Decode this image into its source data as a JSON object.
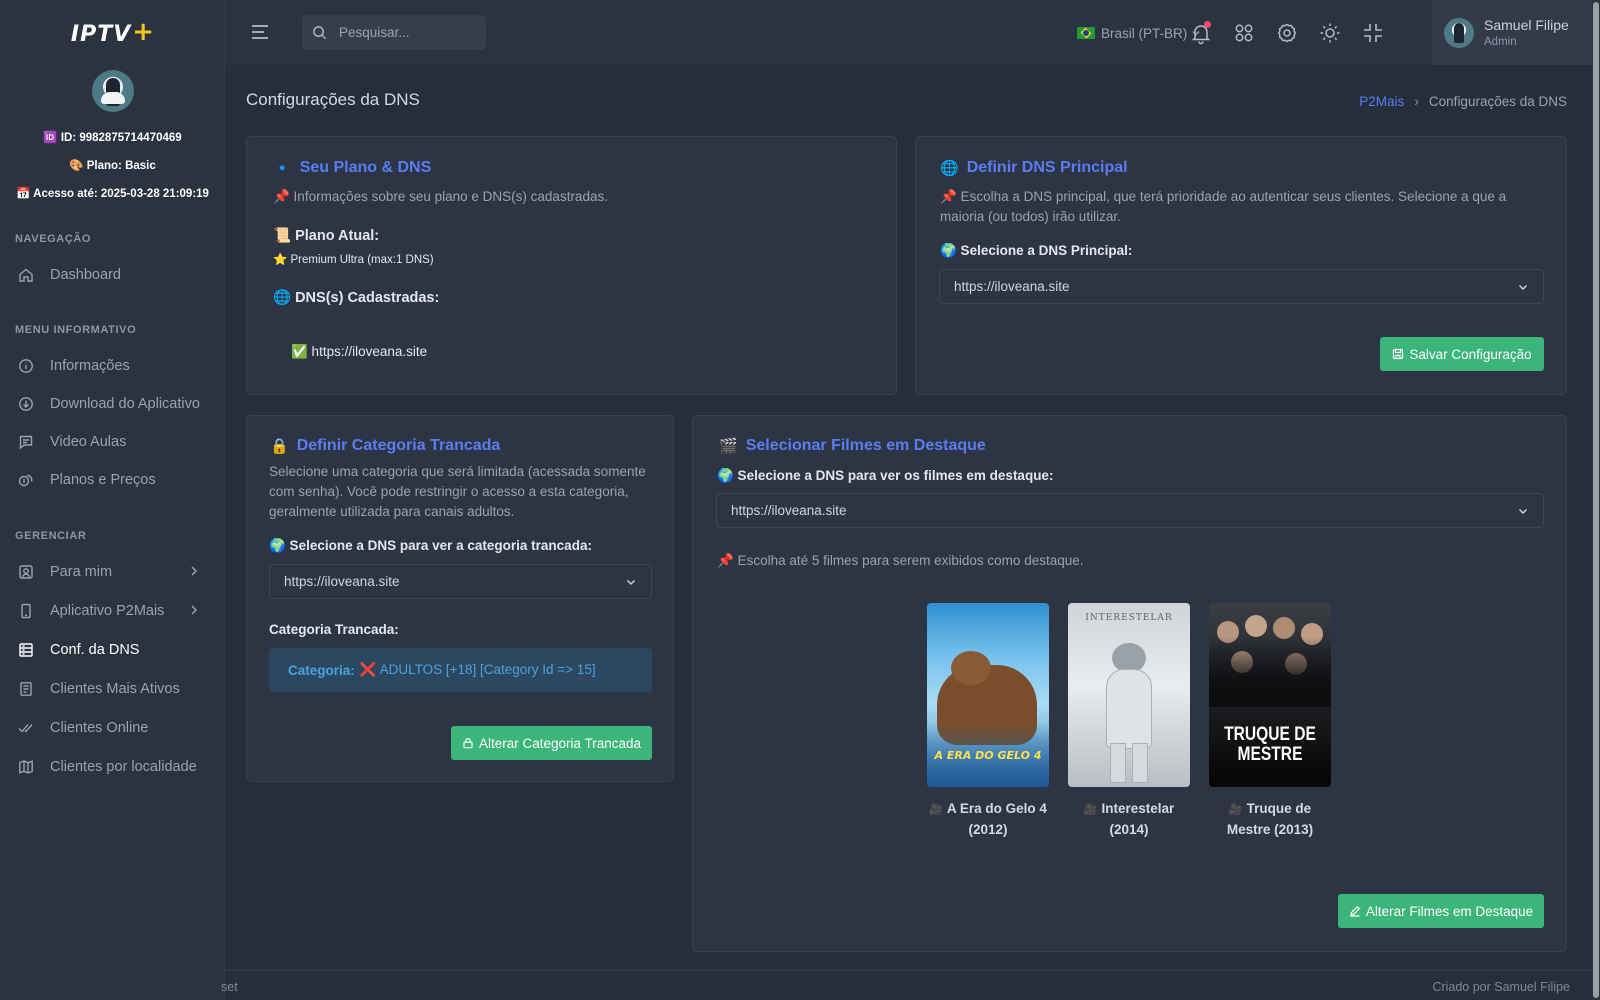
{
  "sidebar": {
    "logo_text": "IPTV",
    "logo_plus": "+",
    "id_text": "🆔 ID: 9982875714470469",
    "plan_text": "🎨 Plano: Basic",
    "access_text": "📅 Acesso até: 2025-03-28 21:09:19",
    "sections": {
      "nav": "NAVEGAÇÃO",
      "info": "MENU INFORMATIVO",
      "manage": "GERENCIAR"
    },
    "items": {
      "dashboard": "Dashboard",
      "informacoes": "Informações",
      "download": "Download do Aplicativo",
      "video_aulas": "Video Aulas",
      "planos": "Planos e Preços",
      "para_mim": "Para mim",
      "aplicativo": "Aplicativo P2Mais",
      "conf_dns": "Conf. da DNS",
      "clientes_ativos": "Clientes Mais Ativos",
      "clientes_online": "Clientes Online",
      "clientes_localidade": "Clientes por localidade"
    }
  },
  "topbar": {
    "search_placeholder": "Pesquisar...",
    "language": "Brasil (PT-BR)",
    "user_name": "Samuel Filipe",
    "user_role": "Admin"
  },
  "page": {
    "title": "Configurações da DNS",
    "breadcrumb_link": "P2Mais",
    "breadcrumb_sep": "›",
    "breadcrumb_current": "Configurações da DNS"
  },
  "plan_card": {
    "icon": "🔹",
    "title": "Seu Plano & DNS",
    "subtitle": "📌 Informações sobre seu plano e DNS(s) cadastradas.",
    "plan_label": "📜 Plano Atual:",
    "plan_value": "⭐ Premium Ultra (max:1 DNS)",
    "dns_label": "🌐 DNS(s) Cadastradas:",
    "dns_item": "✅ https://iloveana.site"
  },
  "dns_card": {
    "icon": "🌐",
    "title": "Definir DNS Principal",
    "desc": "📌 Escolha a DNS principal, que terá prioridade ao autenticar seus clientes. Selecione a que a maioria (ou todos) irão utilizar.",
    "select_label": "🌍 Selecione a DNS Principal:",
    "select_value": "https://iloveana.site",
    "button": "Salvar Configuração"
  },
  "locked_card": {
    "icon": "🔒",
    "title": "Definir Categoria Trancada",
    "desc": "Selecione uma categoria que será limitada (acessada somente com senha). Você pode restringir o acesso a esta categoria, geralmente utilizada para canais adultos.",
    "select_label": "🌍 Selecione a DNS para ver a categoria trancada:",
    "select_value": "https://iloveana.site",
    "category_label": "Categoria Trancada:",
    "category_key": "Categoria:",
    "category_value": "❌ ADULTOS [+18] [Category Id => 15]",
    "button": "Alterar Categoria Trancada"
  },
  "movies_card": {
    "icon": "🎬",
    "title": "Selecionar Filmes em Destaque",
    "select_label": "🌍 Selecione a DNS para ver os filmes em destaque:",
    "select_value": "https://iloveana.site",
    "hint": "📌 Escolha até 5 filmes para serem exibidos como destaque.",
    "movies": [
      {
        "line1": "A Era do Gelo 4",
        "line2": "(2012)",
        "poster_text": "A ERA DO GELO 4"
      },
      {
        "line1": "Interestelar",
        "line2": "(2014)",
        "poster_text": "INTERESTELAR"
      },
      {
        "line1": "Truque de",
        "line2": "Mestre (2013)",
        "poster_text": "TRUQUE DE MESTRE"
      }
    ],
    "button": "Alterar Filmes em Destaque"
  },
  "footer": {
    "left": "set",
    "right": "Criado por Samuel Filipe"
  }
}
